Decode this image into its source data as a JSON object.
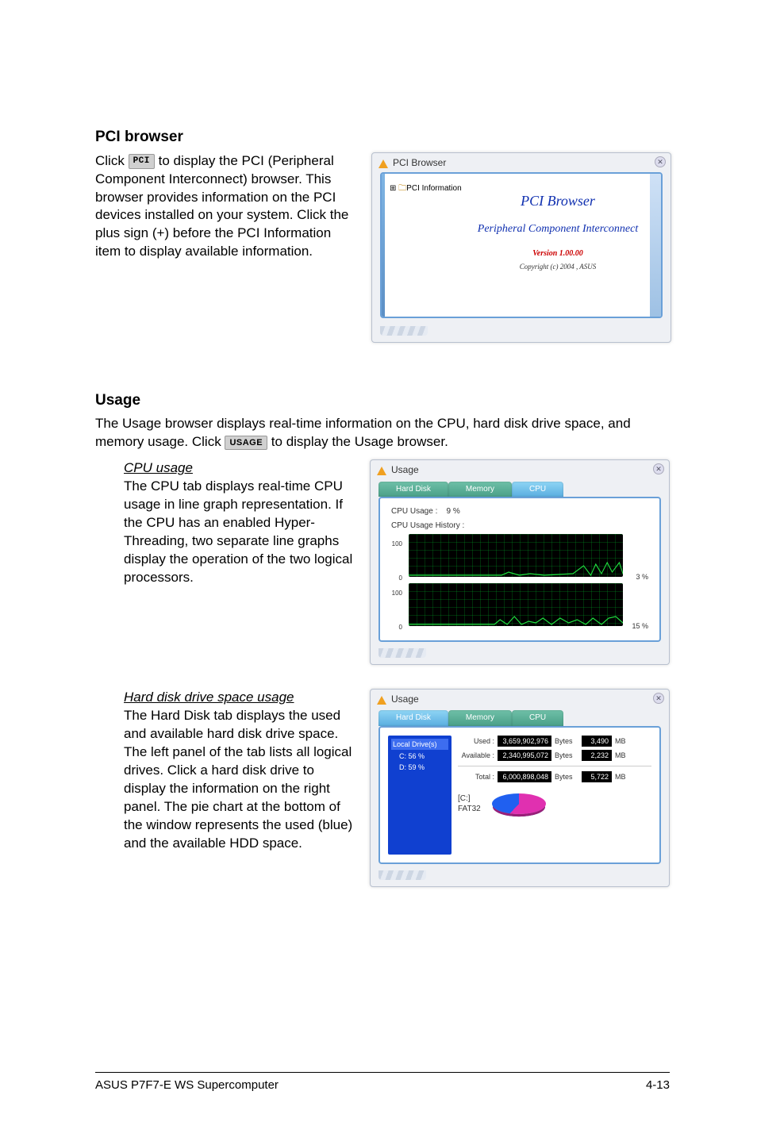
{
  "section1": {
    "heading": "PCI browser",
    "para_a": "Click ",
    "btn": "PCI",
    "para_b": " to display the PCI (Peripheral Component Interconnect) browser. This browser provides information on the PCI devices installed on your system. Click the plus sign (+) before the PCI Information item to display available information."
  },
  "pci_window": {
    "title": "PCI Browser",
    "tree_item": "PCI Information",
    "main_title": "PCI Browser",
    "subtitle": "Peripheral Component Interconnect",
    "version": "Version 1.00.00",
    "copyright": "Copyright (c) 2004 , ASUS"
  },
  "section2": {
    "heading": "Usage",
    "para_a": "The Usage browser displays real-time information on the CPU, hard disk drive space, and memory usage. Click ",
    "btn": "USAGE",
    "para_b": " to display the Usage browser."
  },
  "cpu_block": {
    "heading": "CPU usage",
    "para": "The CPU tab displays real-time CPU usage in line graph representation. If the CPU has an enabled Hyper-Threading, two separate line graphs display the operation of the two logical processors."
  },
  "cpu_window": {
    "title": "Usage",
    "tabs": {
      "hd": "Hard Disk",
      "mem": "Memory",
      "cpu": "CPU"
    },
    "usage_label": "CPU Usage :",
    "usage_value": "9  %",
    "history_label": "CPU Usage History :",
    "y_top": "100",
    "y_bot": "0",
    "pct1": "3 %",
    "pct2": "15 %"
  },
  "hdd_block": {
    "heading": "Hard disk drive space usage",
    "para": "The Hard Disk tab displays the used and available hard disk drive space. The left panel of the tab lists all logical drives. Click a hard disk drive to display the information on the right panel. The pie chart at the bottom of the window represents the used (blue) and the available HDD space."
  },
  "hdd_window": {
    "title": "Usage",
    "tabs": {
      "hd": "Hard Disk",
      "mem": "Memory",
      "cpu": "CPU"
    },
    "tree": {
      "root": "Local Drive(s)",
      "c": "C: 56 %",
      "d": "D: 59 %"
    },
    "used_l": "Used :",
    "used_v": "3,659,902,976",
    "used_u": "Bytes",
    "used_m": "3,490",
    "mb": "MB",
    "avail_l": "Available :",
    "avail_v": "2,340,995,072",
    "avail_u": "Bytes",
    "avail_m": "2,232",
    "total_l": "Total :",
    "total_v": "6,000,898,048",
    "total_u": "Bytes",
    "total_m": "5,722",
    "drive_label": "[C:]",
    "fs_label": "FAT32"
  },
  "footer": {
    "left": "ASUS P7F7-E WS Supercomputer",
    "right": "4-13"
  }
}
